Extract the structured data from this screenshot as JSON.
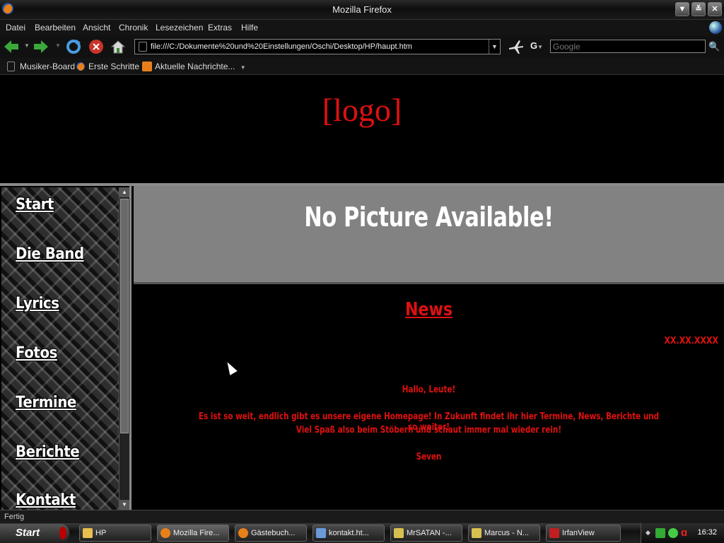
{
  "window": {
    "title": "Mozilla Firefox"
  },
  "menu": [
    "Datei",
    "Bearbeiten",
    "Ansicht",
    "Chronik",
    "Lesezeichen",
    "Extras",
    "Hilfe"
  ],
  "address": {
    "url": "file:///C:/Dokumente%20und%20Einstellungen/Oschi/Desktop/HP/haupt.htm"
  },
  "search": {
    "engine_icon": "G",
    "placeholder": "Google"
  },
  "bookmarks": [
    "Musiker-Board",
    "Erste Schritte",
    "Aktuelle Nachrichte..."
  ],
  "page": {
    "logo": "[logo]",
    "banner": "No Picture Available!",
    "news_title": "News",
    "date": "XX.XX.XXXX",
    "greeting": "Hallo, Leute!",
    "line1": "Es ist so weit, endlich gibt es unsere eigene Homepage! In Zukunft findet ihr hier Termine, News, Berichte und so weiter!",
    "line2": "Viel Spaß also beim Stöbern und schaut immer mal wieder rein!",
    "signature": "Seven",
    "nav": [
      "Start",
      "Die Band",
      "Lyrics",
      "Fotos",
      "Termine",
      "Berichte",
      "Kontakt"
    ]
  },
  "status": "Fertig",
  "taskbar": {
    "start": "Start",
    "tasks": [
      "HP",
      "Mozilla Fire...",
      "Gästebuch...",
      "kontakt.ht...",
      "MrSATAN -...",
      "Marcus - N...",
      "IrfanView"
    ],
    "clock": "16:32"
  },
  "colors": {
    "accent_red": "#e01010",
    "banner_grey": "#828282"
  }
}
